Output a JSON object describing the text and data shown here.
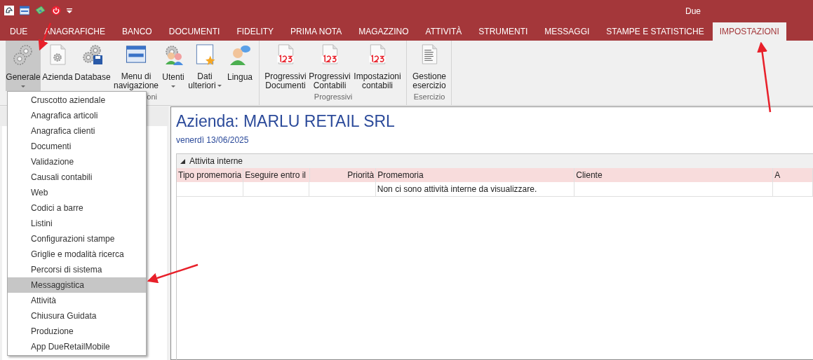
{
  "window": {
    "title": "Due"
  },
  "tabs": [
    {
      "label": "DUE",
      "selected": false
    },
    {
      "label": "ANAGRAFICHE",
      "selected": false
    },
    {
      "label": "BANCO",
      "selected": false
    },
    {
      "label": "DOCUMENTI",
      "selected": false
    },
    {
      "label": "FIDELITY",
      "selected": false
    },
    {
      "label": "PRIMA NOTA",
      "selected": false
    },
    {
      "label": "MAGAZZINO",
      "selected": false
    },
    {
      "label": "ATTIVITÀ",
      "selected": false
    },
    {
      "label": "STRUMENTI",
      "selected": false
    },
    {
      "label": "MESSAGGI",
      "selected": false
    },
    {
      "label": "STAMPE E STATISTICHE",
      "selected": false
    },
    {
      "label": "IMPOSTAZIONI",
      "selected": true
    }
  ],
  "ribbon": {
    "groups": [
      {
        "label": "oni",
        "buttons": [
          {
            "lines": [
              "Generale"
            ],
            "kind": "gears",
            "dropdown": true,
            "selected": true
          },
          {
            "lines": [
              "Azienda"
            ],
            "kind": "gear-doc",
            "dropdown": false,
            "selected": false
          },
          {
            "lines": [
              "Database"
            ],
            "kind": "gears-disk",
            "dropdown": false,
            "selected": false
          },
          {
            "lines": [
              "Menu di",
              "navigazione"
            ],
            "kind": "window",
            "dropdown": false,
            "selected": false
          },
          {
            "lines": [
              "Utenti"
            ],
            "kind": "users",
            "dropdown": true,
            "selected": false
          },
          {
            "lines": [
              "Dati",
              "ulteriori"
            ],
            "kind": "doc-star",
            "dropdown": true,
            "selected": false
          },
          {
            "lines": [
              "Lingua"
            ],
            "kind": "user-chat",
            "dropdown": false,
            "selected": false
          }
        ]
      },
      {
        "label": "Progressivi",
        "buttons": [
          {
            "lines": [
              "Progressivi",
              "Documenti"
            ],
            "kind": "doc-123",
            "dropdown": false,
            "selected": false
          },
          {
            "lines": [
              "Progressivi",
              "Contabili"
            ],
            "kind": "doc-123",
            "dropdown": false,
            "selected": false
          },
          {
            "lines": [
              "Impostazioni",
              "contabili"
            ],
            "kind": "doc-123",
            "dropdown": false,
            "selected": false
          }
        ]
      },
      {
        "label": "Esercizio",
        "buttons": [
          {
            "lines": [
              "Gestione",
              "esercizio"
            ],
            "kind": "doc-text",
            "dropdown": false,
            "selected": false
          }
        ]
      }
    ]
  },
  "menu": {
    "items": [
      {
        "label": "Cruscotto aziendale",
        "selected": false
      },
      {
        "label": "Anagrafica articoli",
        "selected": false
      },
      {
        "label": "Anagrafica clienti",
        "selected": false
      },
      {
        "label": "Documenti",
        "selected": false
      },
      {
        "label": "Validazione",
        "selected": false
      },
      {
        "label": "Causali contabili",
        "selected": false
      },
      {
        "label": "Web",
        "selected": false
      },
      {
        "label": "Codici a barre",
        "selected": false
      },
      {
        "label": "Listini",
        "selected": false
      },
      {
        "label": "Configurazioni stampe",
        "selected": false
      },
      {
        "label": "Griglie e modalità ricerca",
        "selected": false
      },
      {
        "label": "Percorsi di sistema",
        "selected": false
      },
      {
        "label": "Messaggistica",
        "selected": true
      },
      {
        "label": "Attività",
        "selected": false
      },
      {
        "label": "Chiusura Guidata",
        "selected": false
      },
      {
        "label": "Produzione",
        "selected": false
      },
      {
        "label": "App DueRetailMobile",
        "selected": false
      }
    ]
  },
  "content": {
    "title": "Azienda: MARLU RETAIL SRL",
    "date": "venerdì 13/06/2025",
    "grid": {
      "group": "Attivita interne",
      "expanded": true,
      "columns": [
        {
          "label": "Tipo promemoria",
          "kind": "text",
          "message": false
        },
        {
          "label": "Eseguire entro il",
          "kind": "text",
          "message": false
        },
        {
          "label": "Priorità",
          "kind": "number",
          "message": false
        },
        {
          "label": "Promemoria",
          "kind": "text",
          "message": true
        },
        {
          "label": "Cliente",
          "kind": "text",
          "message": false
        },
        {
          "label": "A",
          "kind": "text",
          "message": false
        }
      ],
      "empty_message": "Non ci sono attività interne da visualizzare."
    }
  }
}
